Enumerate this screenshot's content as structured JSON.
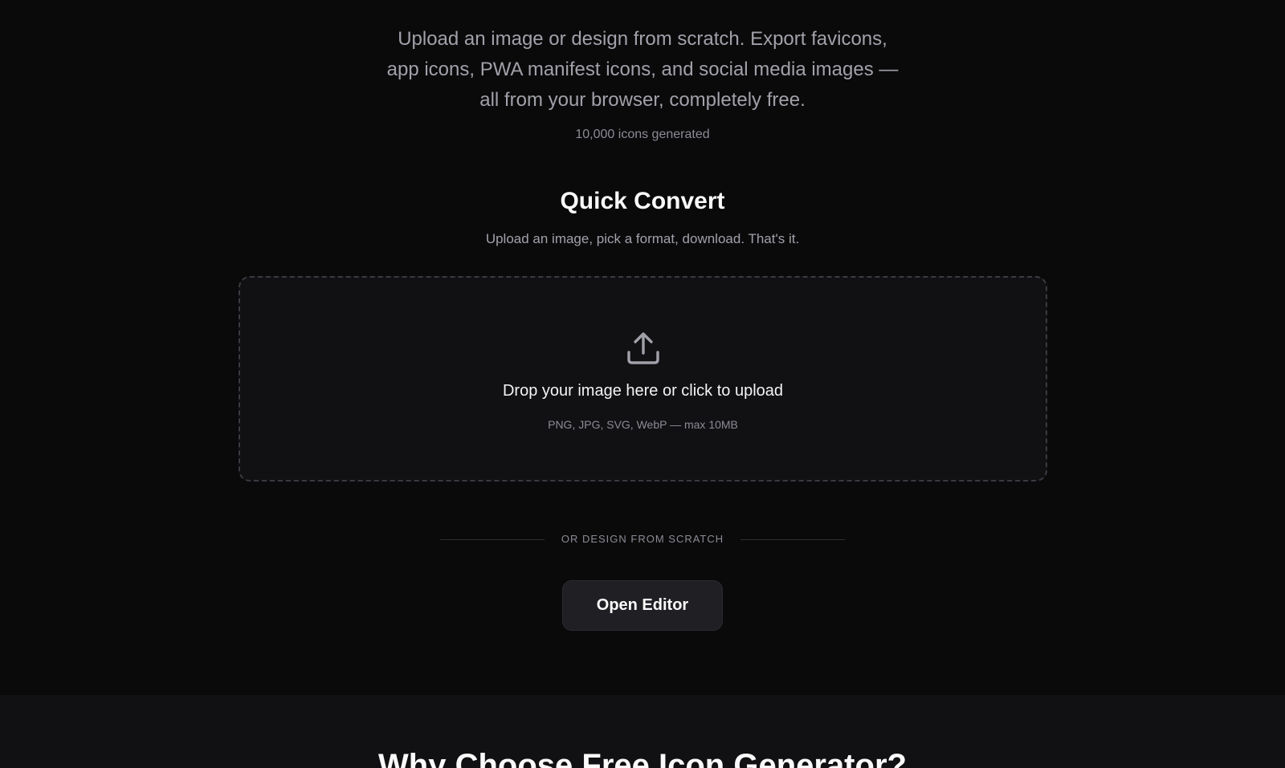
{
  "hero": {
    "description_lines": [
      "Upload an image or design from scratch. Export favicons,",
      "app icons, PWA manifest icons, and social media images —",
      "all from your browser, completely free."
    ],
    "stat": "10,000 icons generated"
  },
  "quick_convert": {
    "title": "Quick Convert",
    "subtitle": "Upload an image, pick a format, download. That's it.",
    "dropzone": {
      "icon": "upload-icon",
      "title": "Drop your image here or click to upload",
      "hint": "PNG, JPG, SVG, WebP — max 10MB"
    },
    "divider_text": "OR DESIGN FROM SCRATCH",
    "editor_button": "Open Editor"
  },
  "why_section": {
    "title": "Why Choose Free Icon Generator?"
  },
  "colors": {
    "background": "#0a0a0b",
    "surface": "#111114",
    "button": "#1f1f24",
    "text": "#fafafa",
    "muted": "#a1a1aa"
  }
}
